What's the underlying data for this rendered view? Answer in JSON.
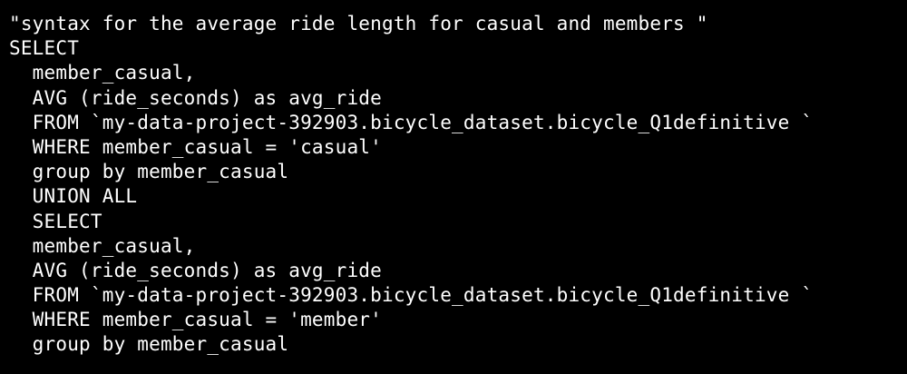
{
  "code": {
    "lines": [
      "\"syntax for the average ride length for casual and members \"",
      "SELECT",
      "  member_casual,",
      "  AVG (ride_seconds) as avg_ride",
      "  FROM `my-data-project-392903.bicycle_dataset.bicycle_Q1definitive `",
      "  WHERE member_casual = 'casual'",
      "  group by member_casual",
      "  UNION ALL",
      "  SELECT",
      "  member_casual,",
      "  AVG (ride_seconds) as avg_ride",
      "  FROM `my-data-project-392903.bicycle_dataset.bicycle_Q1definitive `",
      "  WHERE member_casual = 'member'",
      "  group by member_casual"
    ]
  },
  "colors": {
    "background": "#000000",
    "text": "#ffffff"
  }
}
